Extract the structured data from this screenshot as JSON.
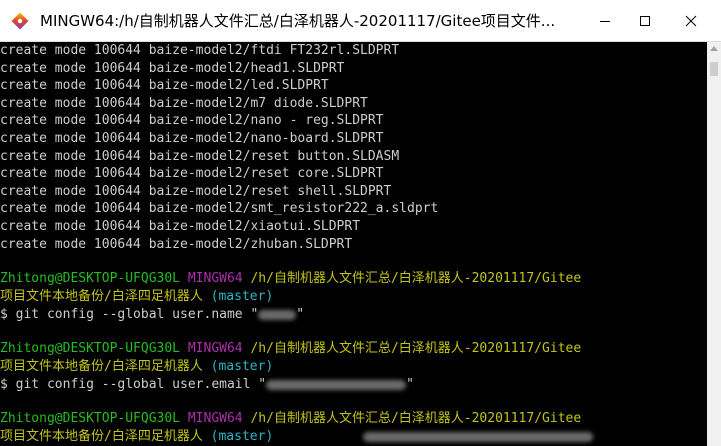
{
  "window": {
    "title": "MINGW64:/h/自制机器人文件汇总/白泽机器人-20201117/Gitee项目文件...",
    "controls": {
      "minimize": "—",
      "maximize": "☐",
      "close": "✕"
    }
  },
  "terminal": {
    "create_lines": [
      "create mode 100644 baize-model2/ftdi FT232rl.SLDPRT",
      "create mode 100644 baize-model2/head1.SLDPRT",
      "create mode 100644 baize-model2/led.SLDPRT",
      "create mode 100644 baize-model2/m7 diode.SLDPRT",
      "create mode 100644 baize-model2/nano - reg.SLDPRT",
      "create mode 100644 baize-model2/nano-board.SLDPRT",
      "create mode 100644 baize-model2/reset button.SLDASM",
      "create mode 100644 baize-model2/reset core.SLDPRT",
      "create mode 100644 baize-model2/reset shell.SLDPRT",
      "create mode 100644 baize-model2/smt_resistor222_a.sldprt",
      "create mode 100644 baize-model2/xiaotui.SLDPRT",
      "create mode 100644 baize-model2/zhuban.SLDPRT"
    ],
    "prompt": {
      "user_host": "Zhitong@DESKTOP-UFQG30L",
      "env": "MINGW64",
      "path_part1": "/h/自制机器人文件汇总/白泽机器人-20201117/Gitee",
      "path_part2": "项目文件本地备份/白泽四足机器人",
      "branch": "(master)"
    },
    "commands": [
      {
        "prefix": "$ git config --global user.name \"",
        "suffix": "\""
      },
      {
        "prefix": "$ git config --global user.email \"",
        "suffix": "\""
      }
    ]
  },
  "colors": {
    "user_host": "#25bc24",
    "env": "#ad2fad",
    "path": "#c3c41b",
    "branch": "#2fb4c7",
    "text": "#c0c0c0"
  }
}
